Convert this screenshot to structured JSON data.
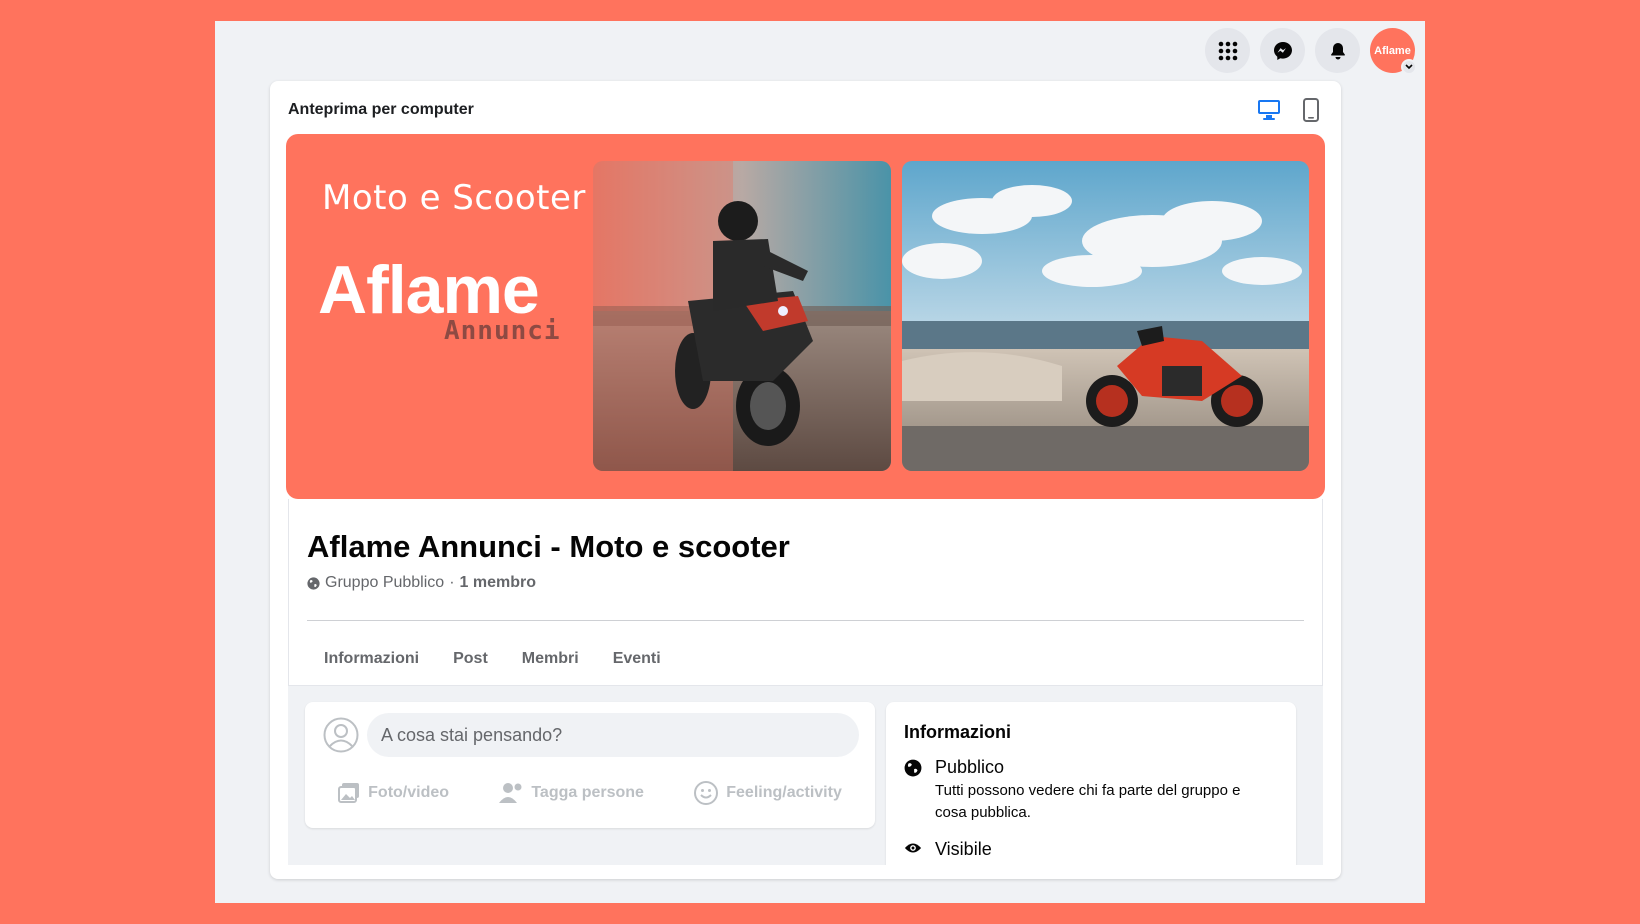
{
  "topbar": {
    "menu_icon": "grid-menu-icon",
    "messenger_icon": "messenger-icon",
    "notifications_icon": "bell-icon",
    "avatar_label": "Aflame"
  },
  "preview": {
    "title": "Anteprima per computer",
    "desktop_icon": "desktop-icon",
    "mobile_icon": "mobile-icon"
  },
  "cover": {
    "subtitle": "Moto e Scooter",
    "brand": "Aflame",
    "brand_sub": "Annunci"
  },
  "group": {
    "name": "Aflame Annunci - Moto e scooter",
    "privacy": "Gruppo Pubblico",
    "separator": "·",
    "members": "1 membro",
    "tabs": [
      {
        "label": "Informazioni"
      },
      {
        "label": "Post"
      },
      {
        "label": "Membri"
      },
      {
        "label": "Eventi"
      }
    ]
  },
  "composer": {
    "placeholder": "A cosa stai pensando?",
    "actions": [
      {
        "label": "Foto/video",
        "icon": "photo-icon"
      },
      {
        "label": "Tagga persone",
        "icon": "tag-people-icon"
      },
      {
        "label": "Feeling/activity",
        "icon": "smiley-icon"
      }
    ]
  },
  "about": {
    "title": "Informazioni",
    "items": [
      {
        "label": "Pubblico",
        "desc": "Tutti possono vedere chi fa parte del gruppo e cosa pubblica.",
        "icon": "globe-icon"
      },
      {
        "label": "Visibile",
        "icon": "eye-icon"
      }
    ]
  },
  "colors": {
    "background": "#FF735D",
    "accent_blue": "#1877F2",
    "text_secondary": "#65676B"
  }
}
